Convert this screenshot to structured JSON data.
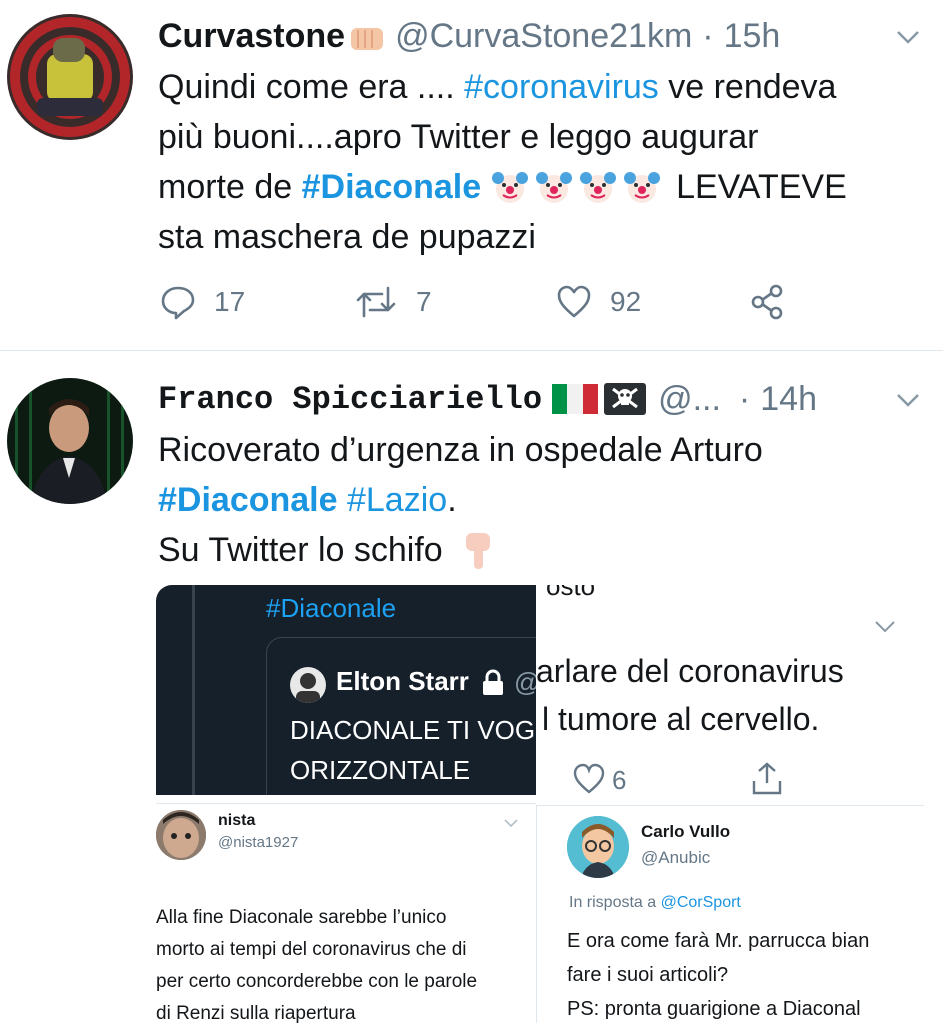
{
  "tweet1": {
    "display_name": "Curvastone",
    "handle": "@CurvaStone21km",
    "dot": "·",
    "time": "15h",
    "text_l1_a": "Quindi come era .... ",
    "hashtag_coronavirus": "#coronavirus",
    "text_l1_b": " ve rendeva",
    "text_l2": "più buoni....apro Twitter e leggo augurar",
    "text_l3_a": "morte de ",
    "hashtag_diaconale": "#Diaconale",
    "text_l3_b": " LEVATEVE",
    "text_l4": "sta maschera de pupazzi",
    "reply_count": "17",
    "retweet_count": "7",
    "like_count": "92"
  },
  "tweet2": {
    "display_name": "Franco Spicciariello",
    "handle": "@...",
    "dot": "·",
    "time": "14h",
    "text_l1": "Ricoverato d’urgenza in ospedale Arturo",
    "hashtag_diaconale": "#Diaconale",
    "hashtag_lazio": "#Lazio",
    "text_l2_end": ".",
    "text_l3": "Su Twitter lo schifo"
  },
  "media": {
    "p1_hashtag": "#Diaconale",
    "p1_name": "Elton Starr",
    "p1_handle": "@",
    "p1_text_l1": "DIACONALE TI VOG",
    "p1_text_l2": "ORIZZONTALE",
    "p2_text_top": "osto",
    "p2_text_l1": "arlare del coronavirus",
    "p2_text_l2": "l tumore al cervello.",
    "p2_like_count": "6",
    "p3_name": "nista",
    "p3_handle": "@nista1927",
    "p3_text_l1": "Alla fine Diaconale sarebbe l’unico",
    "p3_text_l2": "morto ai tempi del coronavirus che di",
    "p3_text_l3": "per certo concorderebbe con le parole",
    "p3_text_l4": "di Renzi sulla riapertura",
    "p4_name": "Carlo Vullo",
    "p4_handle": "@Anubic",
    "p4_reply_prefix": "In risposta a ",
    "p4_reply_to": "@CorSport",
    "p4_text_l1": "E ora come farà Mr. parrucca bian",
    "p4_text_l2": "fare i suoi articoli?",
    "p4_text_l3": "PS: pronta guarigione a Diaconal"
  }
}
